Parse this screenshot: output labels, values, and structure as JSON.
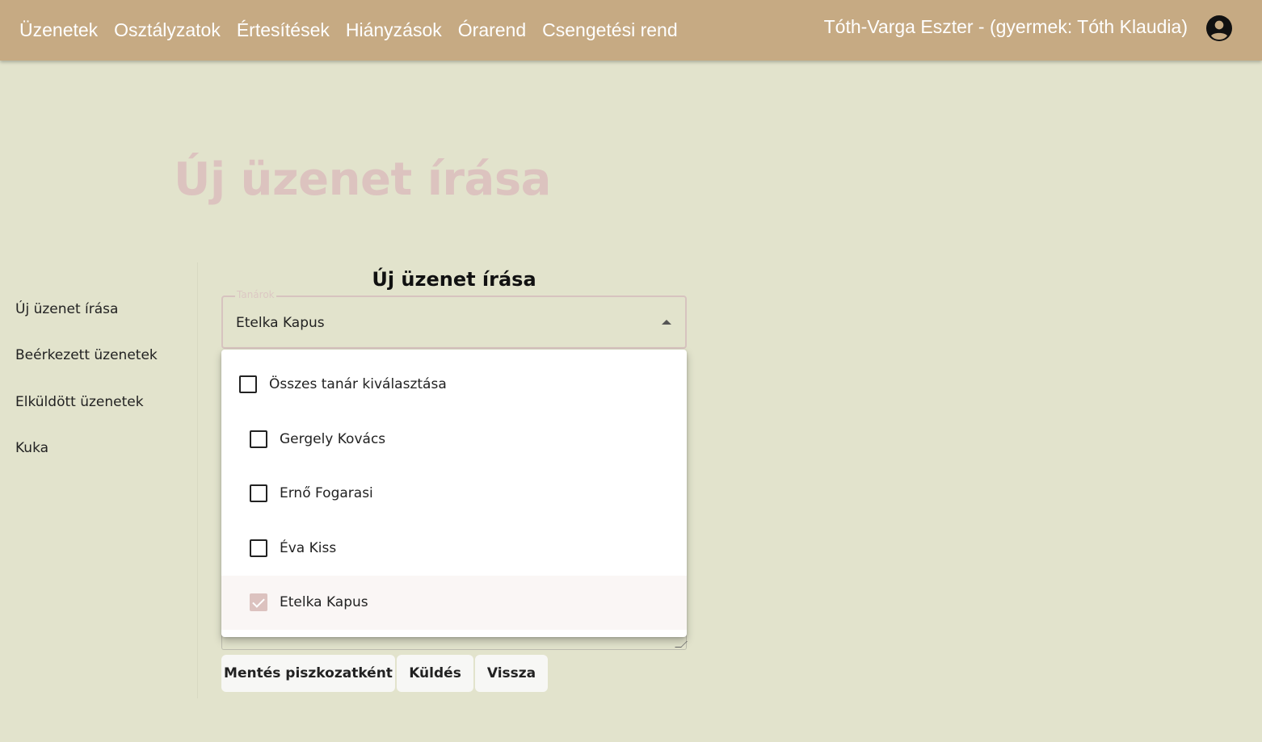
{
  "nav": {
    "items": [
      "Üzenetek",
      "Osztályzatok",
      "Értesítések",
      "Hiányzások",
      "Órarend",
      "Csengetési rend"
    ],
    "user": "Tóth-Varga Eszter - (gyermek: Tóth Klaudia)",
    "avatar_icon": "account-circle-icon"
  },
  "page": {
    "heading": "Új üzenet írása"
  },
  "sidebar": {
    "items": [
      "Új üzenet írása",
      "Beérkezett üzenetek",
      "Elküldött üzenetek",
      "Kuka"
    ]
  },
  "form": {
    "title": "Új üzenet írása",
    "teachers_label": "Tanárok",
    "teachers_value": "Etelka Kapus",
    "dropdown": {
      "select_all": "Összes tanár kiválasztása",
      "options": [
        {
          "label": "Gergely Kovács",
          "checked": false
        },
        {
          "label": "Ernő Fogarasi",
          "checked": false
        },
        {
          "label": "Éva Kiss",
          "checked": false
        },
        {
          "label": "Etelka Kapus",
          "checked": true
        }
      ]
    },
    "buttons": {
      "save_draft": "Mentés piszkozatként",
      "send": "Küldés",
      "back": "Vissza"
    }
  },
  "colors": {
    "background": "#e2e3cc",
    "topbar": "#c6aa83",
    "accent": "#dcc2bf"
  }
}
